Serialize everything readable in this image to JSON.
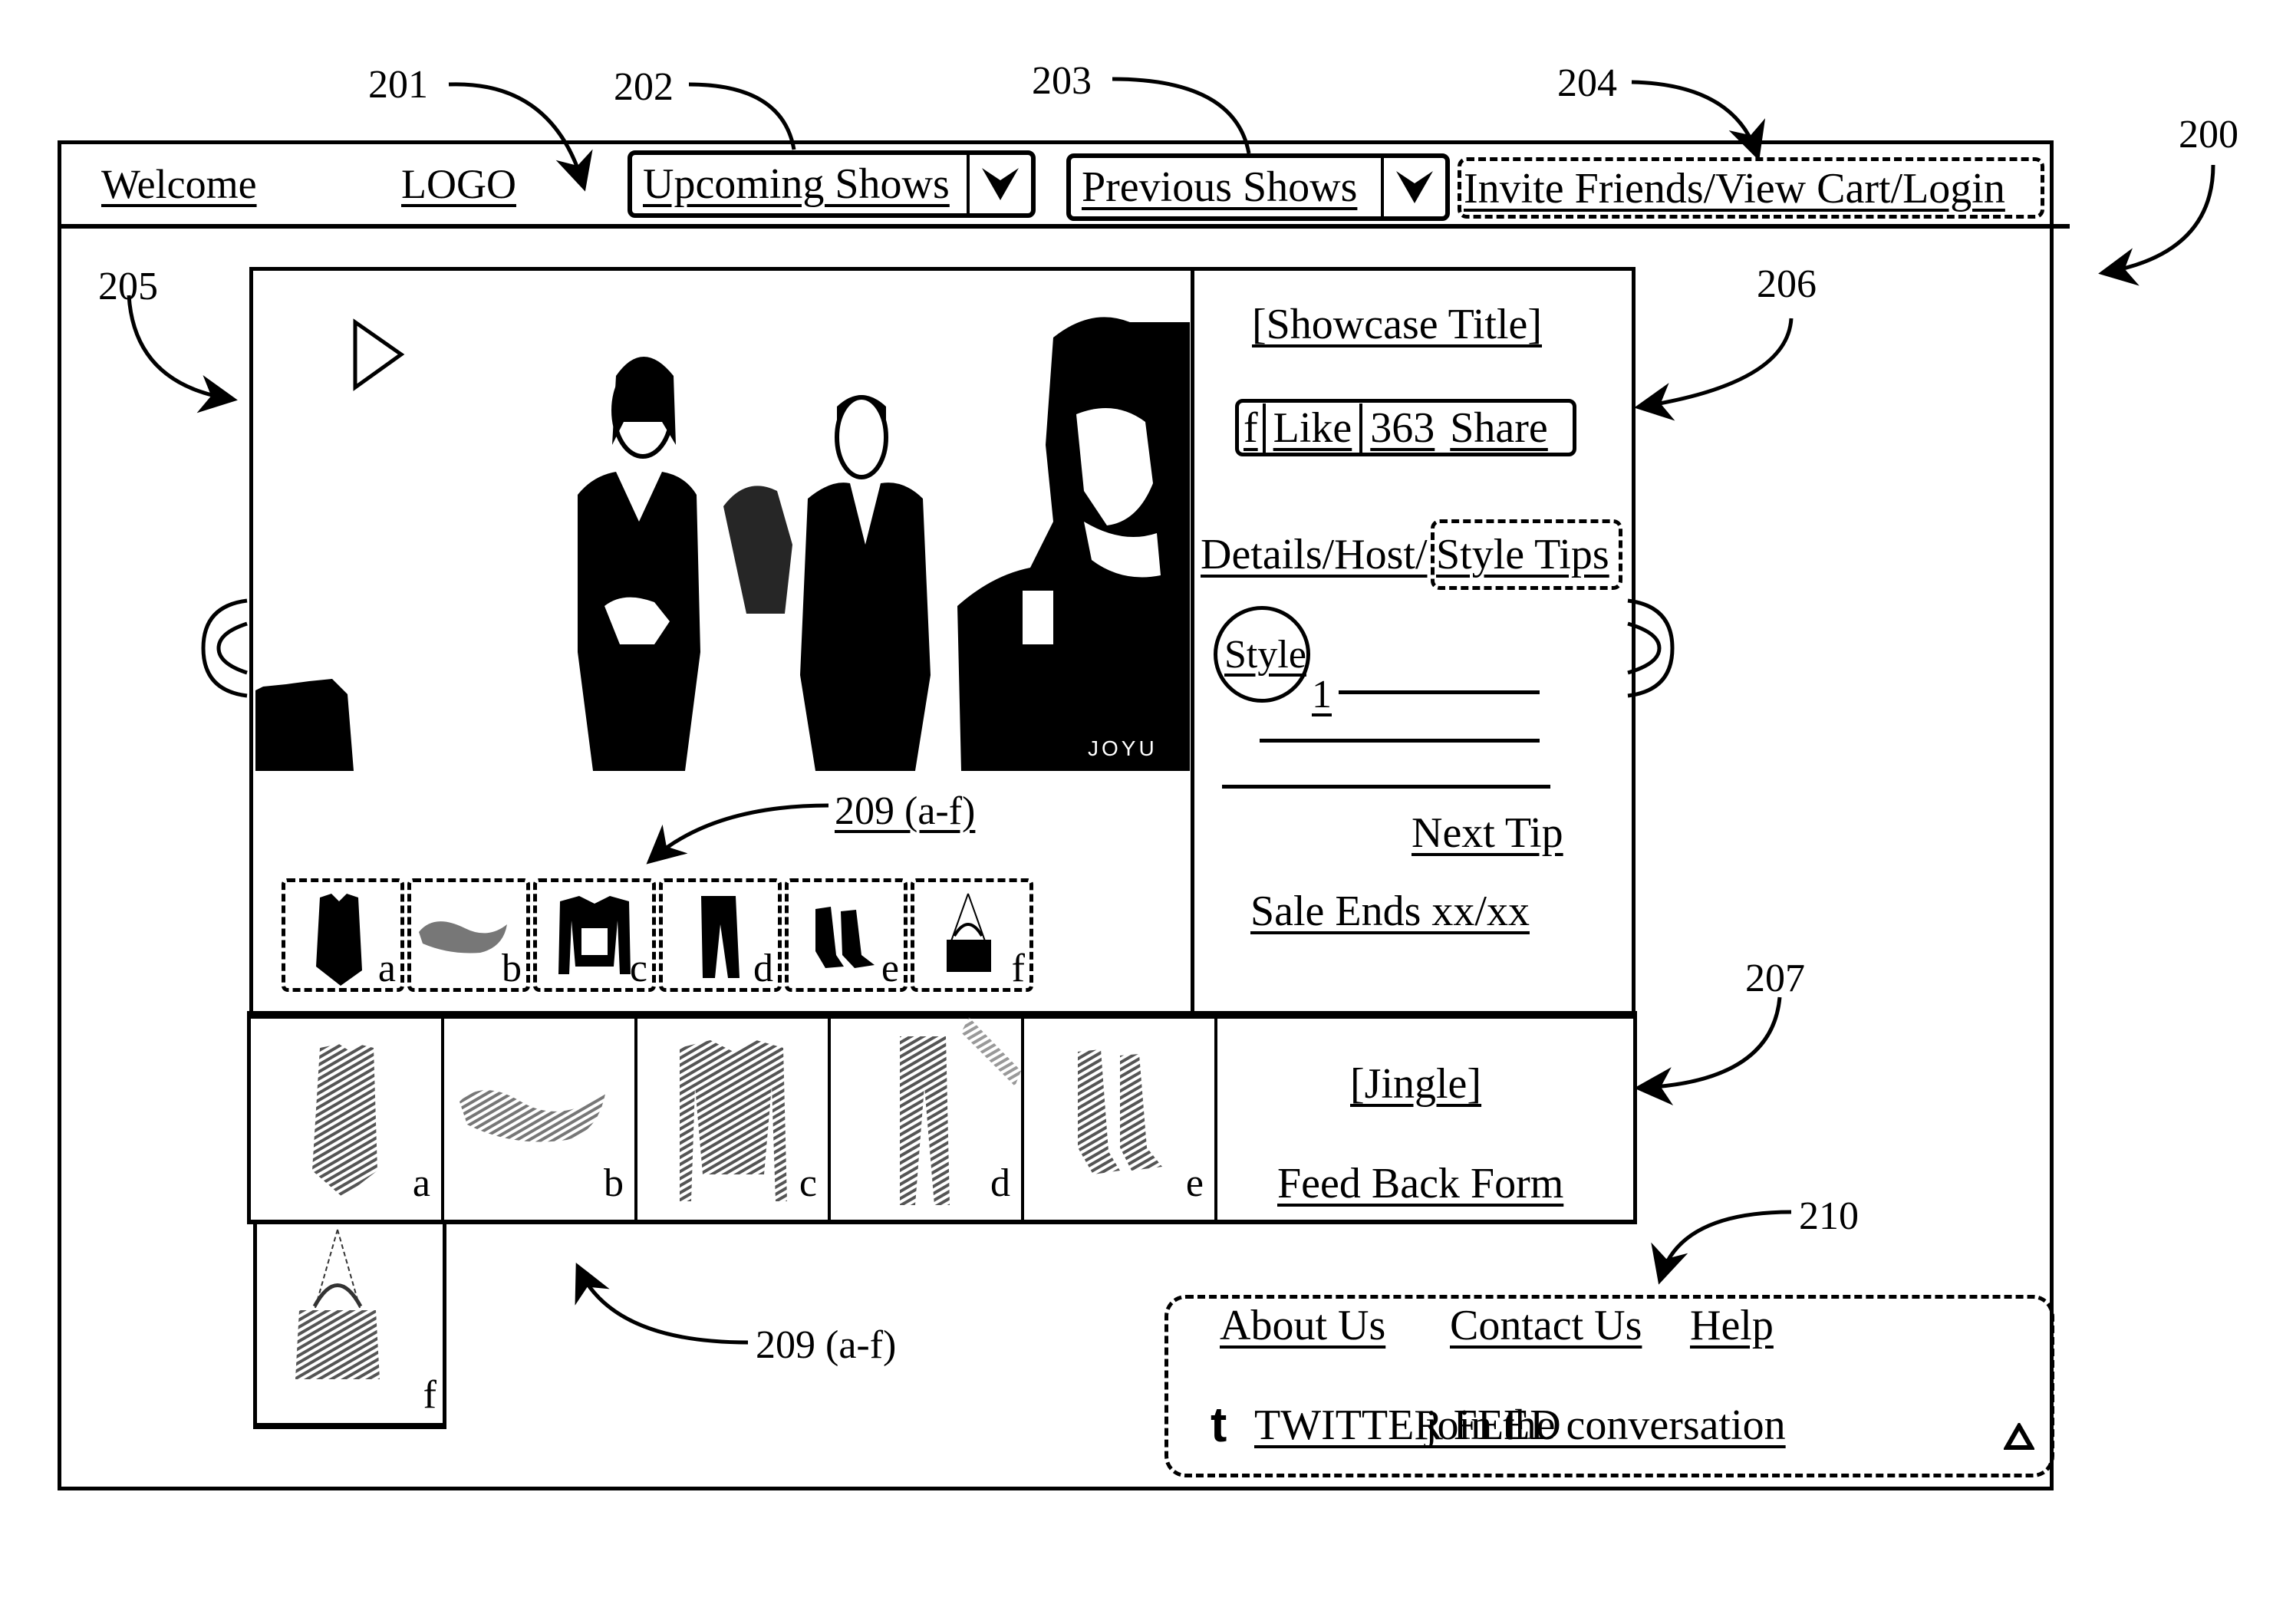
{
  "figure": {
    "reference_labels": {
      "window": "200",
      "logo_area": "201",
      "upcoming_shows": "202",
      "previous_shows": "203",
      "account_links": "204",
      "video_panel": "205",
      "info_panel": "206",
      "jingle_panel": "207",
      "product_items_top": "209 (a-f)",
      "product_items_bottom": "209 (a-f)",
      "footer": "210"
    }
  },
  "header": {
    "welcome": "Welcome",
    "logo": "LOGO",
    "upcoming_shows": "Upcoming Shows",
    "previous_shows": "Previous Shows",
    "account_links": "Invite Friends/View Cart/Login"
  },
  "video": {
    "watermark": "JOYU",
    "play_icon": "play-icon"
  },
  "info_panel": {
    "showcase_title": "[Showcase Title]",
    "facebook_glyph": "f",
    "like_label": "Like",
    "like_count": "363",
    "share_label": "Share",
    "tab_details": "Details/Host/",
    "tab_style_tips": "Style Tips",
    "style_badge": "Style",
    "tip_number": "1",
    "next_tip": "Next Tip",
    "sale_ends": "Sale Ends xx/xx"
  },
  "products": {
    "items": [
      {
        "letter": "a",
        "kind": "vest"
      },
      {
        "letter": "b",
        "kind": "scarf"
      },
      {
        "letter": "c",
        "kind": "jacket"
      },
      {
        "letter": "d",
        "kind": "pants"
      },
      {
        "letter": "e",
        "kind": "boots"
      },
      {
        "letter": "f",
        "kind": "handbag"
      }
    ]
  },
  "jingle_panel": {
    "jingle": "[Jingle]",
    "feedback": "Feed Back Form"
  },
  "footer": {
    "about": "About Us",
    "contact": "Contact Us",
    "help": "Help",
    "twitter_glyph": "t",
    "twitter_feed": "TWITTER FEED",
    "join": "join the conversation",
    "expand_icon": "triangle-up-icon"
  }
}
